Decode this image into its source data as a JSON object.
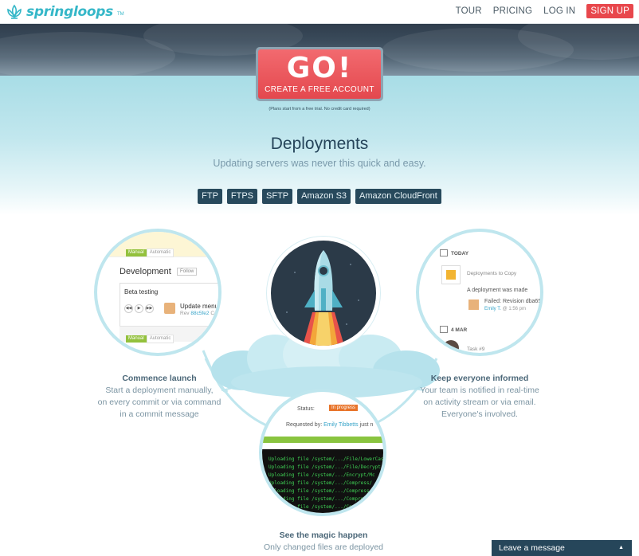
{
  "header": {
    "logo_text": "springloops",
    "logo_tm": "TM",
    "nav": [
      {
        "label": "TOUR"
      },
      {
        "label": "PRICING"
      },
      {
        "label": "LOG IN"
      },
      {
        "label": "SIGN UP"
      }
    ]
  },
  "hero": {
    "cta_big": "GO!",
    "cta_small": "CREATE A FREE ACCOUNT",
    "plans_note": "(Plans start from a free trial. No credit card required)"
  },
  "section": {
    "title": "Deployments",
    "subtitle": "Updating servers was never this quick and easy.",
    "protocols": [
      "FTP",
      "FTPS",
      "SFTP",
      "Amazon S3",
      "Amazon CloudFront"
    ]
  },
  "left_circle": {
    "manual": "Manual",
    "automatic": "Automatic",
    "env_name": "Development",
    "follow": "Follow",
    "branch": "Beta testing",
    "update_text": "Update menu",
    "rev_prefix": "Rev",
    "rev_hash": "88c5fe2",
    "rev_suffix": "Co"
  },
  "right_circle": {
    "today": "TODAY",
    "deploy_title": "Deployments to Copy",
    "deploy_made": "A deployment was made",
    "failed": "Failed: Revision dba65",
    "user": "Emily T.",
    "time": "@ 1:56 pm",
    "date2": "4 MAR",
    "task": "Task #9"
  },
  "bottom_circle": {
    "status_label": "Status:",
    "status_value": "In progress",
    "requested_label": "Requested by:",
    "requested_user": "Emily Tibbetts",
    "requested_suffix": "just n",
    "log_lines": [
      "Uploading file /system/.../File/LowerCas",
      "Uploading file /system/.../File/Decrypt",
      "Uploading file /system/.../Encrypt/Mc",
      "Uploading file /system/.../Compress/",
      "Uploading file /system/.../Compress",
      "Uploading file /system/.../Compress",
      "Uploading file /system/.../Compres"
    ]
  },
  "features": {
    "left": {
      "heading": "Commence launch",
      "lines": [
        "Start a deployment manually,",
        "on every commit or via command",
        "in a commit message"
      ]
    },
    "right": {
      "heading": "Keep everyone informed",
      "lines": [
        "Your team is notified in real-time",
        "on activity stream or via email.",
        "Everyone's involved."
      ]
    },
    "bottom": {
      "heading": "See the magic happen",
      "lines": [
        "Only changed files are deployed"
      ]
    }
  },
  "chat": {
    "label": "Leave a message"
  },
  "colors": {
    "accent": "#e8474c",
    "brand": "#35b7c8",
    "dark": "#27495c",
    "terminal_green": "#3fcf54"
  }
}
